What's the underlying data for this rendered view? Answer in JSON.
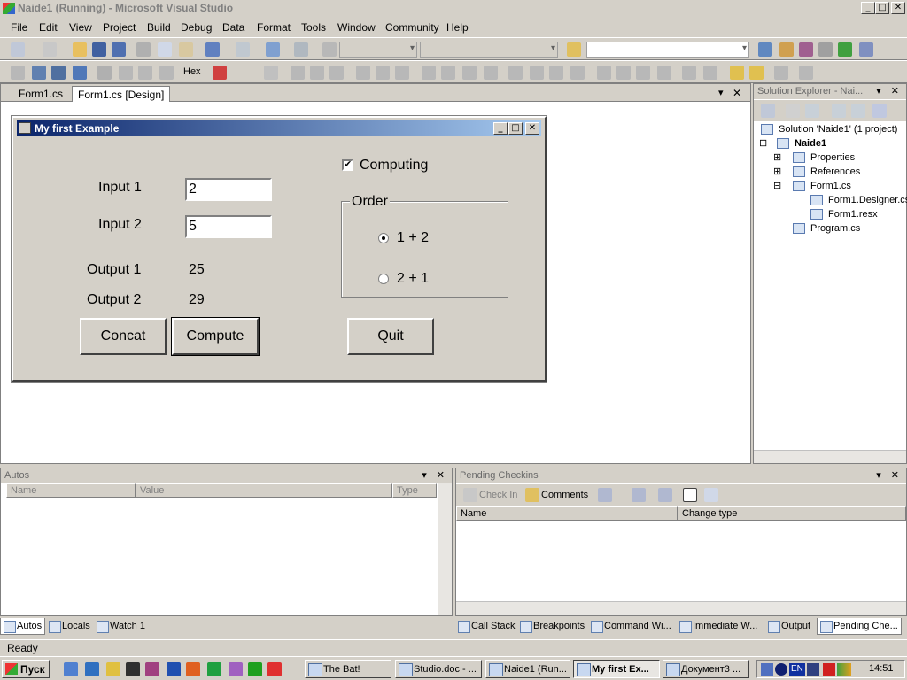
{
  "window": {
    "title": "Naide1 (Running) - Microsoft Visual Studio",
    "min": "_",
    "max": "□",
    "close": "✕"
  },
  "menu": [
    "File",
    "Edit",
    "View",
    "Project",
    "Build",
    "Debug",
    "Data",
    "Format",
    "Tools",
    "Window",
    "Community",
    "Help"
  ],
  "toolbar": {
    "hex_label": "Hex"
  },
  "doc_tabs": [
    {
      "label": "Form1.cs"
    },
    {
      "label": "Form1.cs [Design]"
    }
  ],
  "doc_controls": {
    "dropdown": "▾",
    "close": "✕"
  },
  "form": {
    "title": "My first Example",
    "input1_label": "Input 1",
    "input1_value": "2",
    "input2_label": "Input 2",
    "input2_value": "5",
    "output1_label": "Output 1",
    "output1_value": "25",
    "output2_label": "Output 2",
    "output2_value": "29",
    "concat_label": "Concat",
    "compute_label": "Compute",
    "quit_label": "Quit",
    "computing_label": "Computing",
    "computing_checked": true,
    "order_label": "Order",
    "order_opt1": "1 + 2",
    "order_opt2": "2 + 1",
    "selected_order": "1 + 2"
  },
  "solution_explorer": {
    "title": "Solution Explorer - Nai...",
    "items": [
      {
        "label": "Solution 'Naide1' (1 project)"
      },
      {
        "label": "Naide1"
      },
      {
        "label": "Properties"
      },
      {
        "label": "References"
      },
      {
        "label": "Form1.cs"
      },
      {
        "label": "Form1.Designer.cs"
      },
      {
        "label": "Form1.resx"
      },
      {
        "label": "Program.cs"
      }
    ]
  },
  "autos": {
    "title": "Autos",
    "columns": [
      "Name",
      "Value",
      "Type"
    ]
  },
  "pending": {
    "title": "Pending Checkins",
    "check_in": "Check In",
    "comments": "Comments",
    "columns": [
      "Name",
      "Change type"
    ]
  },
  "bottom_left_tabs": [
    "Autos",
    "Locals",
    "Watch 1"
  ],
  "bottom_right_tabs": [
    "Call Stack",
    "Breakpoints",
    "Command Wi...",
    "Immediate W...",
    "Output",
    "Pending Che..."
  ],
  "status": "Ready",
  "taskbar": {
    "start": "Пуск",
    "tasks": [
      "The Bat!",
      "Studio.doc - ...",
      "Naide1 (Run...",
      "My first Ex...",
      "Документ3 ..."
    ],
    "lang": "EN",
    "clock": "14:51"
  }
}
